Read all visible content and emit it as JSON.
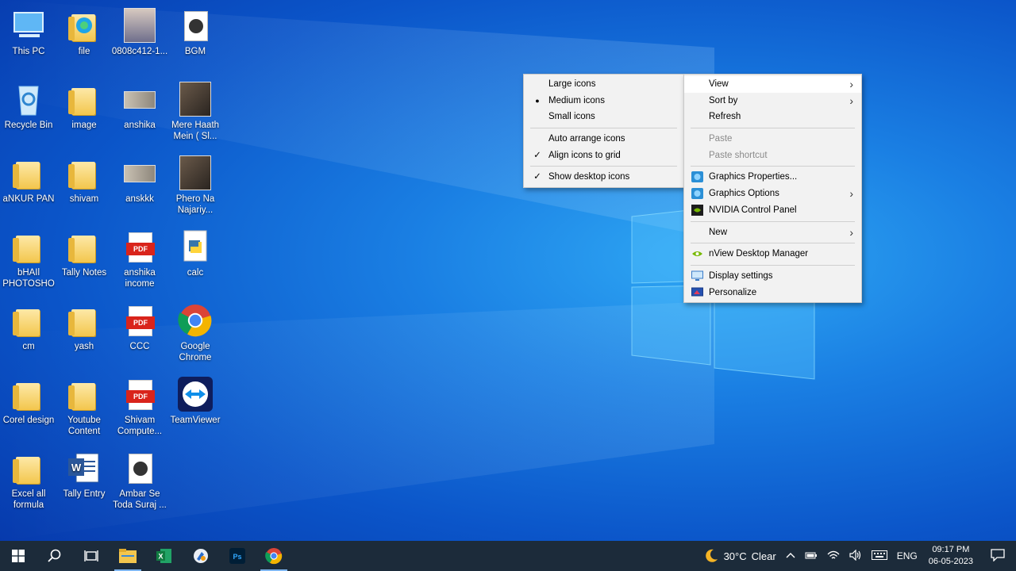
{
  "desktop": {
    "icons": [
      {
        "label": "This PC",
        "icon": "this-pc-icon"
      },
      {
        "label": "file",
        "icon": "edge-shortcut-icon"
      },
      {
        "label": "0808c412-1...",
        "icon": "photo-thumbnail-icon"
      },
      {
        "label": "BGM",
        "icon": "media-file-icon"
      },
      {
        "label": "Recycle Bin",
        "icon": "recycle-bin-icon"
      },
      {
        "label": "image",
        "icon": "folder-icon"
      },
      {
        "label": "anshika",
        "icon": "image-file-icon"
      },
      {
        "label": "Mere Haath Mein ( Sl...",
        "icon": "video-thumbnail-icon"
      },
      {
        "label": "aNKUR PAN",
        "icon": "folder-icon"
      },
      {
        "label": "shivam",
        "icon": "folder-icon"
      },
      {
        "label": "anskkk",
        "icon": "image-file-icon"
      },
      {
        "label": "Phero Na Najariy...",
        "icon": "video-thumbnail-icon"
      },
      {
        "label": "bHAIl PHOTOSHO",
        "icon": "folder-icon"
      },
      {
        "label": "Tally Notes",
        "icon": "folder-icon"
      },
      {
        "label": "anshika income",
        "icon": "pdf-icon"
      },
      {
        "label": "calc",
        "icon": "python-file-icon"
      },
      {
        "label": "cm",
        "icon": "folder-icon"
      },
      {
        "label": "yash",
        "icon": "folder-icon"
      },
      {
        "label": "CCC",
        "icon": "pdf-icon"
      },
      {
        "label": "Google Chrome",
        "icon": "chrome-icon"
      },
      {
        "label": "Corel design",
        "icon": "folder-icon"
      },
      {
        "label": "Youtube Content",
        "icon": "folder-icon"
      },
      {
        "label": "Shivam Compute...",
        "icon": "pdf-icon"
      },
      {
        "label": "TeamViewer",
        "icon": "teamviewer-icon"
      },
      {
        "label": "Excel all formula",
        "icon": "folder-icon"
      },
      {
        "label": "Tally Entry",
        "icon": "word-doc-icon"
      },
      {
        "label": "Ambar Se Toda Suraj ...",
        "icon": "media-file-icon"
      }
    ]
  },
  "context_menu": {
    "items": [
      {
        "label": "View",
        "submenu": true
      },
      {
        "label": "Sort by",
        "submenu": true
      },
      {
        "label": "Refresh"
      },
      {
        "label": "Paste",
        "disabled": true
      },
      {
        "label": "Paste shortcut",
        "disabled": true
      },
      {
        "label": "Graphics Properties...",
        "icon": "intel-graphics-icon"
      },
      {
        "label": "Graphics Options",
        "icon": "intel-graphics-icon",
        "submenu": true
      },
      {
        "label": "NVIDIA Control Panel",
        "icon": "nvidia-icon"
      },
      {
        "label": "New",
        "submenu": true
      },
      {
        "label": "nView Desktop Manager",
        "icon": "nview-icon"
      },
      {
        "label": "Display settings",
        "icon": "display-icon"
      },
      {
        "label": "Personalize",
        "icon": "personalize-icon"
      }
    ]
  },
  "view_submenu": {
    "items": [
      {
        "label": "Large icons"
      },
      {
        "label": "Medium icons",
        "mark": "●"
      },
      {
        "label": "Small icons"
      },
      {
        "label": "Auto arrange icons"
      },
      {
        "label": "Align icons to grid",
        "mark": "✓"
      },
      {
        "label": "Show desktop icons",
        "mark": "✓"
      }
    ]
  },
  "taskbar": {
    "weather_temp": "30°C",
    "weather_desc": "Clear",
    "language": "ENG",
    "time": "09:17 PM",
    "date": "06-05-2023"
  },
  "colors": {
    "taskbar_bg": "#1c2b3a",
    "menu_bg": "#f2f2f2",
    "accent": "#1a7fe3"
  }
}
